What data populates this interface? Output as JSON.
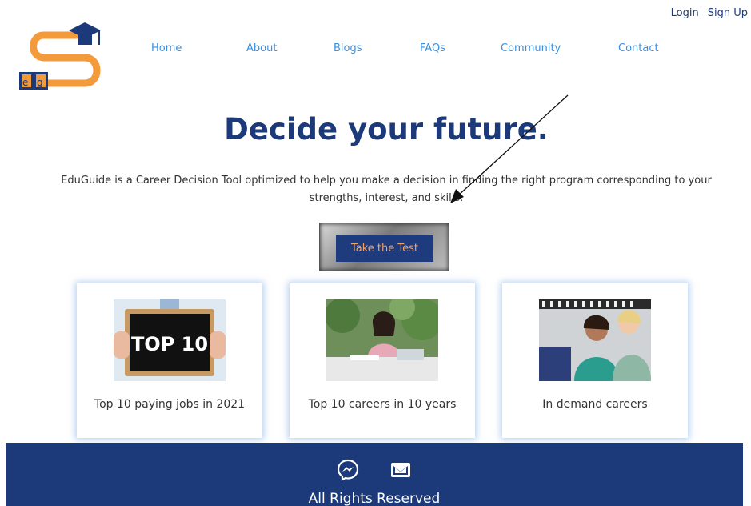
{
  "header": {
    "auth": {
      "login": "Login",
      "signup": "Sign Up"
    },
    "logo": {
      "letters": "eg",
      "colors": {
        "orange": "#f39a3a",
        "navy": "#1c3a7a"
      }
    }
  },
  "nav": {
    "items": [
      {
        "label": "Home"
      },
      {
        "label": "About"
      },
      {
        "label": "Blogs"
      },
      {
        "label": "FAQs"
      },
      {
        "label": "Community"
      },
      {
        "label": "Contact"
      }
    ]
  },
  "hero": {
    "title": "Decide your future.",
    "description": "EduGuide is a Career Decision Tool optimized to help you make a decision in finding the right program corresponding to your strengths, interest, and skills.",
    "cta_label": "Take the Test"
  },
  "cards": [
    {
      "caption": "Top 10 paying jobs in 2021",
      "image_text": "TOP 10"
    },
    {
      "caption": "Top 10 careers in 10 years"
    },
    {
      "caption": "In demand careers"
    }
  ],
  "footer": {
    "icons": [
      "messenger-icon",
      "mail-icon"
    ],
    "rights": "All Rights Reserved"
  },
  "colors": {
    "navy": "#1c3a7a",
    "link_blue": "#3b8fe0",
    "cta_text": "#f0a36a"
  }
}
